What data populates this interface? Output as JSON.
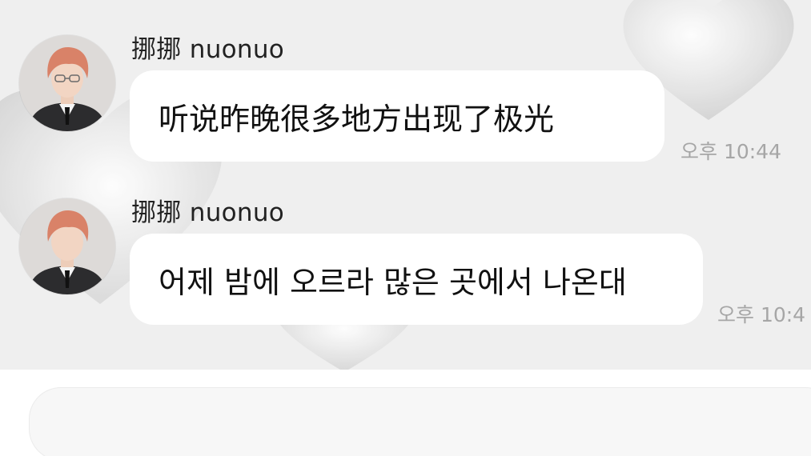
{
  "chat": {
    "messages": [
      {
        "sender": "挪挪 nuonuo",
        "text": "听说昨晚很多地方出现了极光",
        "time": "오후 10:44"
      },
      {
        "sender": "挪挪 nuonuo",
        "text": "어제 밤에 오르라 많은 곳에서 나온대",
        "time": "오후 10:4"
      }
    ]
  },
  "composer": {
    "placeholder": ""
  },
  "colors": {
    "chat_background": "#efefef",
    "bubble": "#ffffff",
    "timestamp": "#a6a6a6",
    "sender_text": "#222222",
    "avatar_hair": "#d98268"
  }
}
